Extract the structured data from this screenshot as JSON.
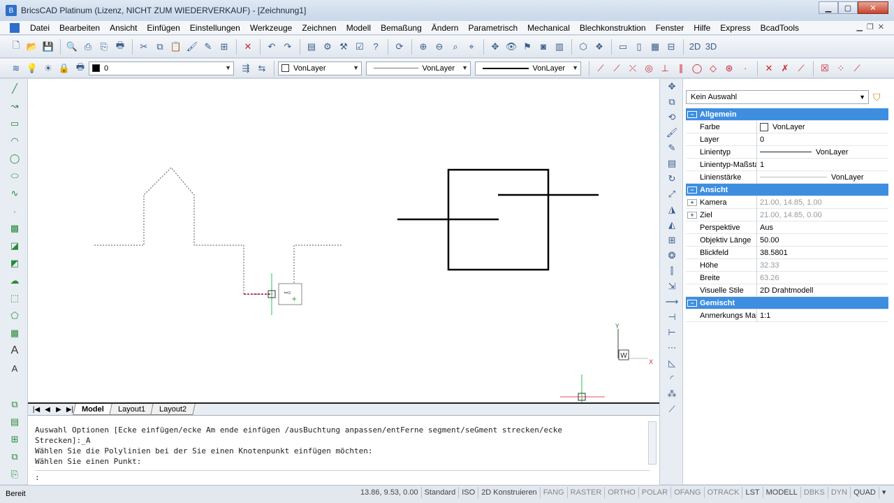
{
  "window": {
    "title": "BricsCAD Platinum (Lizenz, NICHT ZUM WIEDERVERKAUF) - [Zeichnung1]"
  },
  "menu": [
    "Datei",
    "Bearbeiten",
    "Ansicht",
    "Einfügen",
    "Einstellungen",
    "Werkzeuge",
    "Zeichnen",
    "Modell",
    "Bemaßung",
    "Ändern",
    "Parametrisch",
    "Mechanical",
    "Blechkonstruktion",
    "Fenster",
    "Hilfe",
    "Express",
    "BcadTools"
  ],
  "layer_toolbar": {
    "layer_value": "0",
    "color_value": "VonLayer",
    "linetype_value": "VonLayer",
    "lineweight_value": "VonLayer"
  },
  "layout_tabs": [
    "Model",
    "Layout1",
    "Layout2"
  ],
  "ucs": {
    "y_label": "Y",
    "w_label": "W",
    "x_label": "X"
  },
  "command": {
    "lines": [
      "Auswahl Optionen [Ecke einfügen/ecke Am ende einfügen /ausBuchtung anpassen/entFerne segment/seGment strecken/ecke",
      "Strecken]:_A",
      "Wählen Sie die Polylinien bei der Sie einen Knotenpunkt einfügen möchten:",
      "Wählen Sie einen Punkt:"
    ],
    "prompt": ":"
  },
  "properties": {
    "selection": "Kein Auswahl",
    "sections": [
      {
        "title": "Allgemein",
        "rows": [
          {
            "name": "Farbe",
            "value": "VonLayer"
          },
          {
            "name": "Layer",
            "value": "0"
          },
          {
            "name": "Linientyp",
            "value": "VonLayer"
          },
          {
            "name": "Linientyp-Maßstab",
            "value": "1"
          },
          {
            "name": "Linienstärke",
            "value": "VonLayer"
          }
        ]
      },
      {
        "title": "Ansicht",
        "rows": [
          {
            "name": "Kamera",
            "value": "21.00, 14.85, 1.00"
          },
          {
            "name": "Ziel",
            "value": "21.00, 14.85, 0.00"
          },
          {
            "name": "Perspektive",
            "value": "Aus"
          },
          {
            "name": "Objektiv Länge",
            "value": "50.00"
          },
          {
            "name": "Blickfeld",
            "value": "38.5801"
          },
          {
            "name": "Höhe",
            "value": "32.33"
          },
          {
            "name": "Breite",
            "value": "63.26"
          },
          {
            "name": "Visuelle Stile",
            "value": "2D Drahtmodell"
          }
        ]
      },
      {
        "title": "Gemischt",
        "rows": [
          {
            "name": "Anmerkungs Maß",
            "value": "1:1"
          }
        ]
      }
    ]
  },
  "status": {
    "left": "Bereit",
    "coords": "13.86, 9.53, 0.00",
    "items": [
      "Standard",
      "ISO",
      "2D Konstruieren",
      "FANG",
      "RASTER",
      "ORTHO",
      "POLAR",
      "OFANG",
      "OTRACK",
      "LST",
      "MODELL",
      "DBKS",
      "DYN",
      "QUAD"
    ]
  },
  "colors": {
    "section_header": "#3e8ee0",
    "accent": "#2f6fc8"
  }
}
